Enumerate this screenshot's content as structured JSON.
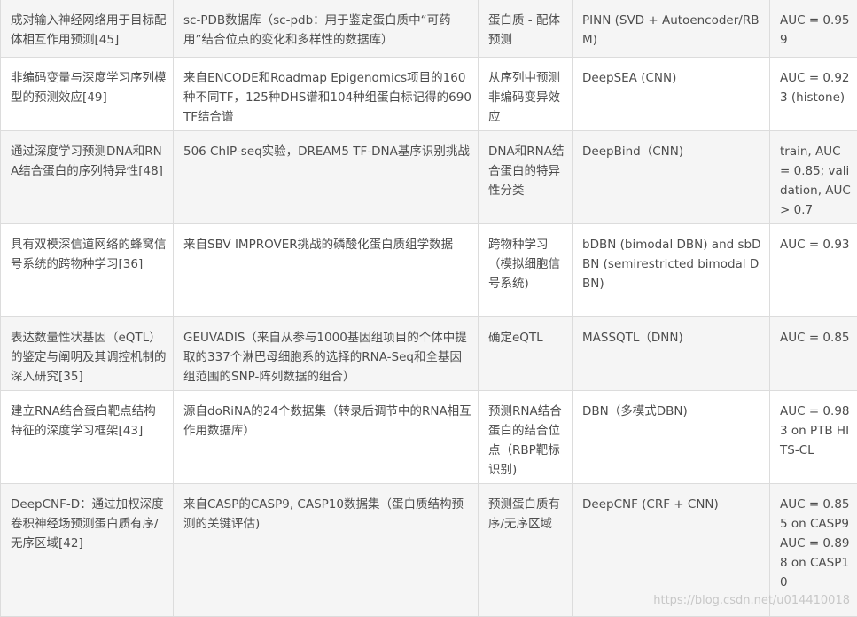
{
  "table": {
    "rows": [
      {
        "task": "成对输入神经网络用于目标配体相互作用预测[45]",
        "data": "sc-PDB数据库（sc-pdb：用于鉴定蛋白质中“可药用”结合位点的变化和多样性的数据库）",
        "goal": "蛋白质 - 配体预测",
        "model": "PINN (SVD + Autoencoder/RBM)",
        "performance": "AUC = 0.959"
      },
      {
        "task": "非编码变量与深度学习序列模型的预测效应[49]",
        "data": "来自ENCODE和Roadmap Epigenomics项目的160种不同TF，125种DHS谱和104种组蛋白标记得的690 TF结合谱",
        "goal": "从序列中预测非编码变异效应",
        "model": "DeepSEA (CNN)",
        "performance": "AUC = 0.923 (histone)"
      },
      {
        "task": "通过深度学习预测DNA和RNA结合蛋白的序列特异性[48]",
        "data": "506 ChIP-seq实验，DREAM5 TF-DNA基序识别挑战",
        "goal": "DNA和RNA结合蛋白的特异性分类",
        "model": "DeepBind（CNN)",
        "performance": "train, AUC = 0.85; validation, AUC > 0.7"
      },
      {
        "task": "具有双模深信道网络的蜂窝信号系统的跨物种学习[36]",
        "data": "来自SBV IMPROVER挑战的磷酸化蛋白质组学数据",
        "goal": "跨物种学习（模拟细胞信号系统)",
        "model": "bDBN (bimodal DBN) and sbDBN (semirestricted bimodal DBN)",
        "performance": "AUC = 0.93"
      },
      {
        "task": "表达数量性状基因（eQTL）的鉴定与阐明及其调控机制的深入研究[35]",
        "data": "GEUVADIS（来自从参与1000基因组项目的个体中提取的337个淋巴母细胞系的选择的RNA-Seq和全基因组范围的SNP-阵列数据的组合）",
        "goal": "确定eQTL",
        "model": "MASSQTL（DNN)",
        "performance": "AUC = 0.85"
      },
      {
        "task": "建立RNA结合蛋白靶点结构特征的深度学习框架[43]",
        "data": "源自doRiNA的24个数据集（转录后调节中的RNA相互作用数据库）",
        "goal": "预测RNA结合蛋白的结合位点（RBP靶标识别)",
        "model": "DBN（多模式DBN)",
        "performance": "AUC = 0.983 on PTB HITS-CL"
      },
      {
        "task": "DeepCNF-D：通过加权深度卷积神经场预测蛋白质有序/无序区域[42]",
        "data": "来自CASP的CASP9, CASP10数据集（蛋白质结构预测的关键评估)",
        "goal": "预测蛋白质有序/无序区域",
        "model": "DeepCNF (CRF + CNN)",
        "performance": "AUC = 0.855 on CASP9 AUC = 0.898 on CASP10"
      }
    ]
  },
  "watermark": "https://blog.csdn.net/u014410018"
}
